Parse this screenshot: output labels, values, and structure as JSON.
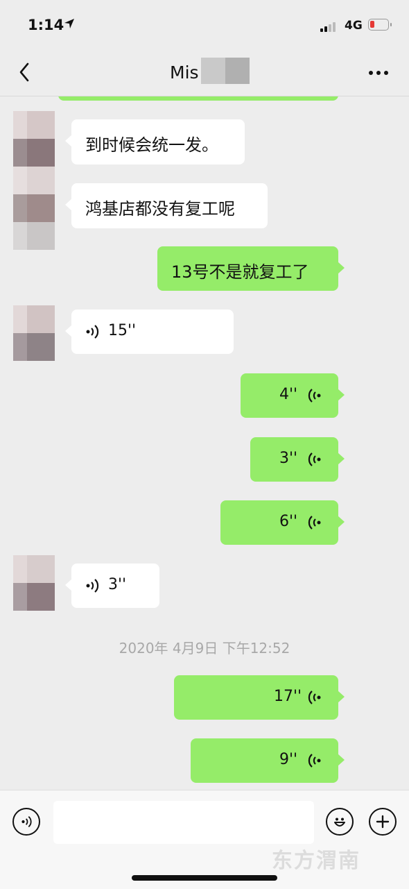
{
  "status_bar": {
    "time": "1:14",
    "network": "4G"
  },
  "nav": {
    "title": "Mis"
  },
  "messages": [
    {
      "side": "in",
      "type": "text",
      "text": "到时候会统一发。"
    },
    {
      "side": "in",
      "type": "text",
      "text": "鸿基店都没有复工呢"
    },
    {
      "side": "out",
      "type": "text",
      "text": "13号不是就复工了"
    },
    {
      "side": "in",
      "type": "voice",
      "duration": "15''"
    },
    {
      "side": "out",
      "type": "voice",
      "duration": "4''"
    },
    {
      "side": "out",
      "type": "voice",
      "duration": "3''"
    },
    {
      "side": "out",
      "type": "voice",
      "duration": "6''"
    },
    {
      "side": "in",
      "type": "voice",
      "duration": "3''"
    },
    {
      "side": "out",
      "type": "voice",
      "duration": "17''"
    },
    {
      "side": "out",
      "type": "voice",
      "duration": "9''"
    }
  ],
  "timestamp": "2020年 4月9日 下午12:52",
  "input": {
    "value": ""
  },
  "icons": {
    "back": "chevron-left-icon",
    "more": "more-dots-icon",
    "voice_toggle": "voice-icon",
    "emoji": "emoji-icon",
    "add": "plus-icon"
  },
  "colors": {
    "bubble_out": "#95ec69",
    "bubble_in": "#ffffff",
    "background": "#ededed"
  }
}
